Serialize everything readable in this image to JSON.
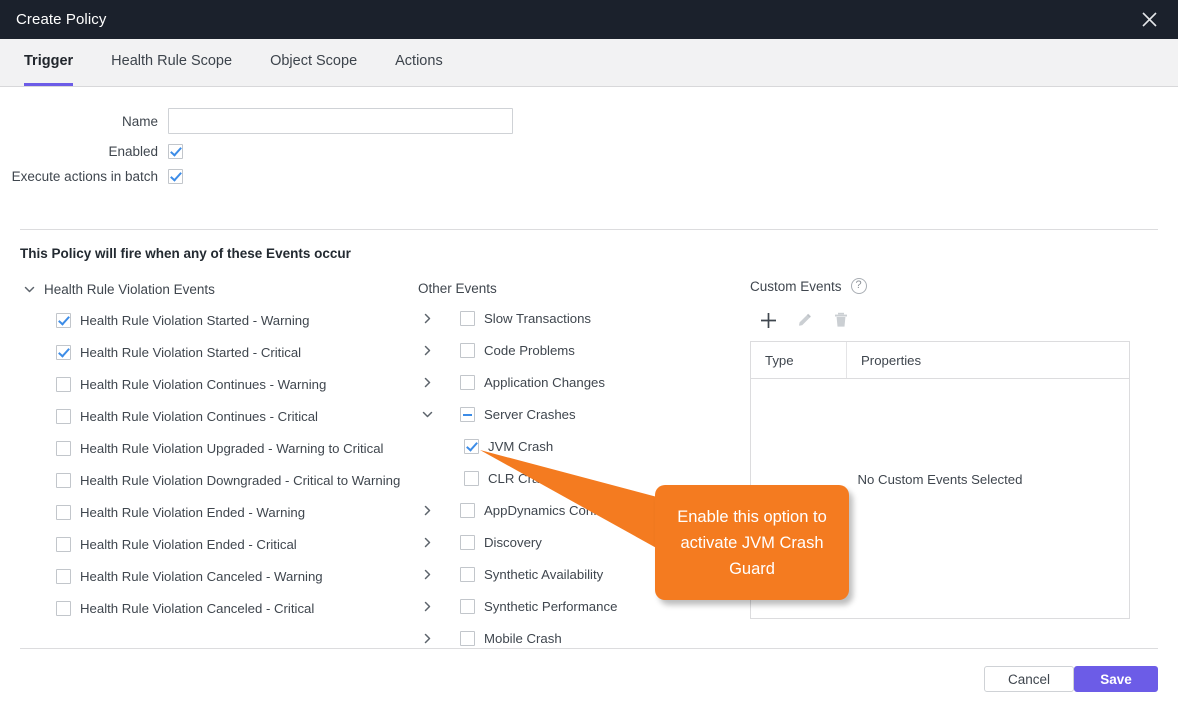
{
  "window": {
    "title": "Create Policy",
    "close_icon": "close-icon"
  },
  "tabs": [
    {
      "label": "Trigger",
      "active": true
    },
    {
      "label": "Health Rule Scope",
      "active": false
    },
    {
      "label": "Object Scope",
      "active": false
    },
    {
      "label": "Actions",
      "active": false
    }
  ],
  "form": {
    "name_label": "Name",
    "name_value": "",
    "name_placeholder": "",
    "enabled_label": "Enabled",
    "enabled_checked": true,
    "batch_label": "Execute actions in batch",
    "batch_checked": true
  },
  "events": {
    "section_title": "This Policy will fire when any of these Events occur",
    "health_rule_group": {
      "label": "Health Rule Violation Events",
      "expanded": true,
      "items": [
        {
          "label": "Health Rule Violation Started - Warning",
          "checked": true
        },
        {
          "label": "Health Rule Violation Started - Critical",
          "checked": true
        },
        {
          "label": "Health Rule Violation Continues - Warning",
          "checked": false
        },
        {
          "label": "Health Rule Violation Continues - Critical",
          "checked": false
        },
        {
          "label": "Health Rule Violation Upgraded - Warning to Critical",
          "checked": false
        },
        {
          "label": "Health Rule Violation Downgraded - Critical to Warning",
          "checked": false
        },
        {
          "label": "Health Rule Violation Ended - Warning",
          "checked": false
        },
        {
          "label": "Health Rule Violation Ended - Critical",
          "checked": false
        },
        {
          "label": "Health Rule Violation Canceled - Warning",
          "checked": false
        },
        {
          "label": "Health Rule Violation Canceled - Critical",
          "checked": false
        }
      ]
    },
    "other_events": {
      "title": "Other Events",
      "items": [
        {
          "label": "Slow Transactions",
          "checked": false,
          "state": "unchecked",
          "expandable": true,
          "expanded": false,
          "child": false
        },
        {
          "label": "Code Problems",
          "checked": false,
          "state": "unchecked",
          "expandable": true,
          "expanded": false,
          "child": false
        },
        {
          "label": "Application Changes",
          "checked": false,
          "state": "unchecked",
          "expandable": true,
          "expanded": false,
          "child": false
        },
        {
          "label": "Server Crashes",
          "checked": false,
          "state": "indeterminate",
          "expandable": true,
          "expanded": true,
          "child": false
        },
        {
          "label": "JVM Crash",
          "checked": true,
          "state": "checked",
          "expandable": false,
          "expanded": false,
          "child": true
        },
        {
          "label": "CLR Crash",
          "checked": false,
          "state": "unchecked",
          "expandable": false,
          "expanded": false,
          "child": true
        },
        {
          "label": "AppDynamics Config Warnings",
          "checked": false,
          "state": "unchecked",
          "expandable": true,
          "expanded": false,
          "child": false
        },
        {
          "label": "Discovery",
          "checked": false,
          "state": "unchecked",
          "expandable": true,
          "expanded": false,
          "child": false
        },
        {
          "label": "Synthetic Availability",
          "checked": false,
          "state": "unchecked",
          "expandable": true,
          "expanded": false,
          "child": false
        },
        {
          "label": "Synthetic Performance",
          "checked": false,
          "state": "unchecked",
          "expandable": true,
          "expanded": false,
          "child": false
        },
        {
          "label": "Mobile Crash",
          "checked": false,
          "state": "unchecked",
          "expandable": true,
          "expanded": false,
          "child": false
        }
      ]
    },
    "custom_events": {
      "title": "Custom Events",
      "help_icon": "help-icon",
      "toolbar": [
        {
          "icon": "add-icon",
          "enabled": true
        },
        {
          "icon": "edit-pencil-icon",
          "enabled": false
        },
        {
          "icon": "delete-trash-icon",
          "enabled": false
        }
      ],
      "columns": [
        "Type",
        "Properties"
      ],
      "empty_text": "No Custom Events Selected",
      "rows": []
    }
  },
  "callout": {
    "text": "Enable this option to activate JVM Crash Guard",
    "color": "#f47b20",
    "points_to": "JVM Crash"
  },
  "footer": {
    "cancel_label": "Cancel",
    "save_label": "Save"
  },
  "colors": {
    "titlebar": "#1b212c",
    "accent": "#6c5ce7",
    "checkbox_check": "#3c8ce7",
    "callout": "#f47b20"
  }
}
